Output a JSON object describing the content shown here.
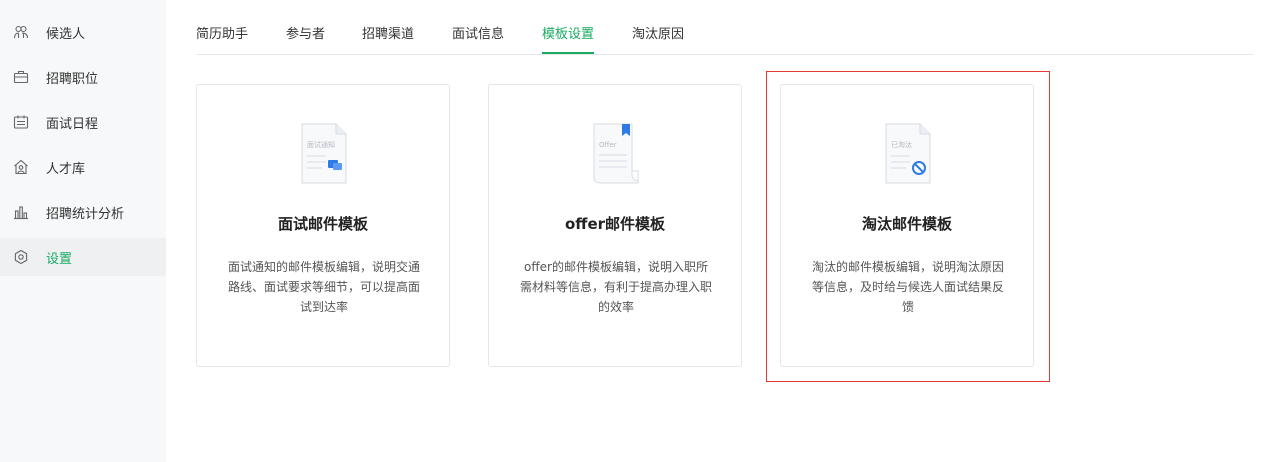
{
  "sidebar": {
    "items": [
      {
        "label": "候选人",
        "icon": "candidates-icon"
      },
      {
        "label": "招聘职位",
        "icon": "briefcase-icon"
      },
      {
        "label": "面试日程",
        "icon": "calendar-icon"
      },
      {
        "label": "人才库",
        "icon": "talent-pool-icon"
      },
      {
        "label": "招聘统计分析",
        "icon": "bar-chart-icon"
      },
      {
        "label": "设置",
        "icon": "settings-icon",
        "active": true
      }
    ]
  },
  "tabs": [
    {
      "label": "简历助手"
    },
    {
      "label": "参与者"
    },
    {
      "label": "招聘渠道"
    },
    {
      "label": "面试信息"
    },
    {
      "label": "模板设置",
      "active": true
    },
    {
      "label": "淘汰原因"
    }
  ],
  "cards": [
    {
      "title": "面试邮件模板",
      "icon_text": "面试通知",
      "description": "面试通知的邮件模板编辑，说明交通路线、面试要求等细节，可以提高面试到达率"
    },
    {
      "title": "offer邮件模板",
      "icon_text": "Offer",
      "description": "offer的邮件模板编辑，说明入职所需材料等信息，有利于提高办理入职的效率"
    },
    {
      "title": "淘汰邮件模板",
      "icon_text": "已淘汰",
      "description": "淘汰的邮件模板编辑，说明淘汰原因等信息，及时给与候选人面试结果反馈"
    }
  ],
  "colors": {
    "accent": "#1aab63",
    "icon_blue": "#2f7be6",
    "highlight": "#e53935"
  }
}
